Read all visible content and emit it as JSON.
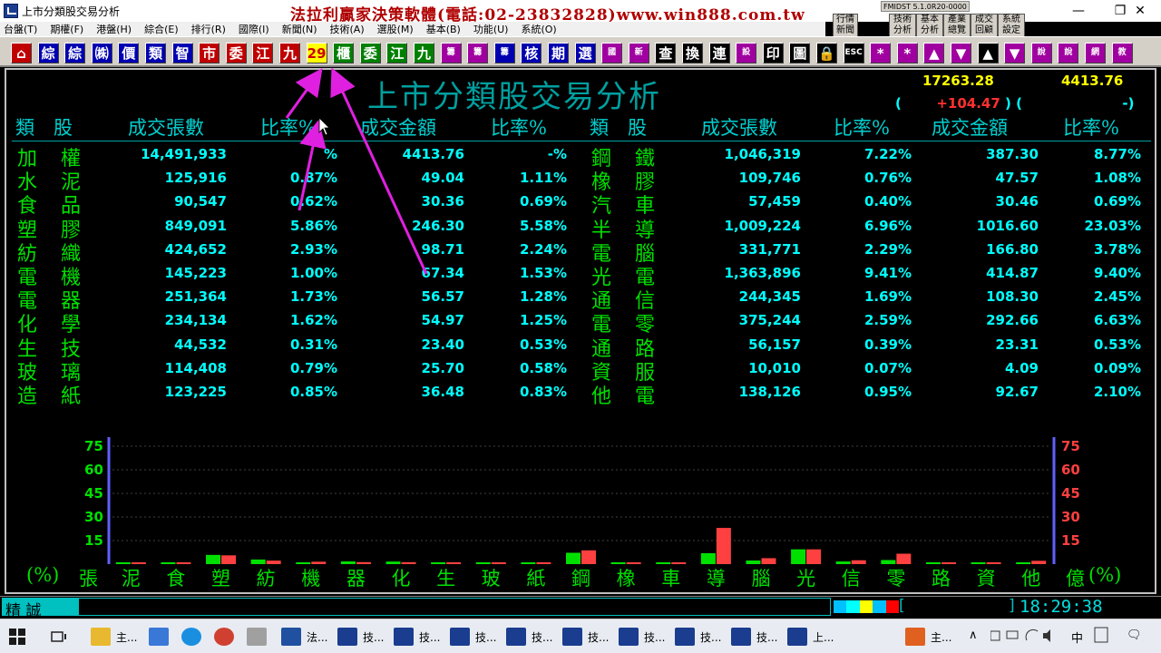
{
  "window": {
    "title": "上市分類股交易分析",
    "banner": "法拉利贏家決策軟體(電話:02-23832828)www.win888.com.tw",
    "version": "FMIDST 5.1.0R20-0000",
    "minimize": "—",
    "maximize": "❐",
    "close": "✕"
  },
  "system_buttons": [
    {
      "l1": "技術",
      "l2": "分析"
    },
    {
      "l1": "基本",
      "l2": "分析"
    },
    {
      "l1": "產業",
      "l2": "總覽"
    },
    {
      "l1": "成交",
      "l2": "回顧"
    },
    {
      "l1": "系統",
      "l2": "設定"
    }
  ],
  "system_small": {
    "l1": "行情",
    "l2": "新聞"
  },
  "menu": [
    "台盤(T)",
    "期權(F)",
    "港盤(H)",
    "綜合(E)",
    "排行(R)",
    "國際(I)",
    "新聞(N)",
    "技術(A)",
    "選股(M)",
    "基本(B)",
    "功能(U)",
    "系統(O)"
  ],
  "toolbar": [
    {
      "label": "⌂",
      "color": "r",
      "icon": "home-icon"
    },
    {
      "label": "綜",
      "color": "b"
    },
    {
      "label": "綜",
      "color": "b"
    },
    {
      "label": "㈱",
      "color": "b"
    },
    {
      "label": "價",
      "color": "b"
    },
    {
      "label": "類",
      "color": "b"
    },
    {
      "label": "智",
      "color": "b"
    },
    {
      "label": "市",
      "color": "r"
    },
    {
      "label": "委",
      "color": "r"
    },
    {
      "label": "江",
      "color": "r"
    },
    {
      "label": "九",
      "color": "r"
    },
    {
      "label": "29",
      "color": "y"
    },
    {
      "label": "櫃",
      "color": "g"
    },
    {
      "label": "委",
      "color": "g"
    },
    {
      "label": "江",
      "color": "g"
    },
    {
      "label": "九",
      "color": "g"
    },
    {
      "label": "籌",
      "color": "m",
      "small": true
    },
    {
      "label": "籌",
      "color": "m",
      "small": true
    },
    {
      "label": "籌",
      "color": "b",
      "small": true
    },
    {
      "label": "核",
      "color": "b"
    },
    {
      "label": "期",
      "color": "b"
    },
    {
      "label": "選",
      "color": "b"
    },
    {
      "label": "國",
      "color": "m",
      "small": true
    },
    {
      "label": "新",
      "color": "m",
      "small": true
    },
    {
      "label": "查",
      "color": "k"
    },
    {
      "label": "換",
      "color": "k"
    },
    {
      "label": "連",
      "color": "k"
    },
    {
      "label": "設",
      "color": "m",
      "small": true
    },
    {
      "label": "印",
      "color": "k"
    },
    {
      "label": "圖",
      "color": "k",
      "icon": "chart-icon"
    },
    {
      "label": "🔒",
      "color": "k",
      "icon": "lock-icon"
    },
    {
      "label": "ESC",
      "color": "k",
      "small": true
    },
    {
      "label": "*",
      "color": "m"
    },
    {
      "label": "*",
      "color": "m"
    },
    {
      "label": "▲",
      "color": "m",
      "icon": "up-icon"
    },
    {
      "label": "▼",
      "color": "m",
      "icon": "down-icon"
    },
    {
      "label": "▲",
      "color": "k",
      "icon": "top-icon"
    },
    {
      "label": "▼",
      "color": "m",
      "icon": "bottom-icon"
    },
    {
      "label": "說",
      "color": "m",
      "small": true
    },
    {
      "label": "說",
      "color": "m",
      "small": true
    },
    {
      "label": "網",
      "color": "m",
      "small": true
    },
    {
      "label": "教",
      "color": "m",
      "small": true
    }
  ],
  "page": {
    "title": "上市分類股交易分析",
    "index_value": "17263.28",
    "index_amount": "4413.76",
    "change_open": "(",
    "change": "+104.47",
    "change_mid": ")   (",
    "change_end": "-)"
  },
  "headers": {
    "category": "類　股",
    "volume": "成交張數",
    "ratio1": "比率%",
    "amount": "成交金額",
    "ratio2": "比率%"
  },
  "left_rows": [
    {
      "name": "加權",
      "volume": "14,491,933",
      "vol_pct": "%",
      "amount": "4413.76",
      "amt_pct": "-%"
    },
    {
      "name": "水泥",
      "volume": "125,916",
      "vol_pct": "0.87%",
      "amount": "49.04",
      "amt_pct": "1.11%"
    },
    {
      "name": "食品",
      "volume": "90,547",
      "vol_pct": "0.62%",
      "amount": "30.36",
      "amt_pct": "0.69%"
    },
    {
      "name": "塑膠",
      "volume": "849,091",
      "vol_pct": "5.86%",
      "amount": "246.30",
      "amt_pct": "5.58%"
    },
    {
      "name": "紡織",
      "volume": "424,652",
      "vol_pct": "2.93%",
      "amount": "98.71",
      "amt_pct": "2.24%"
    },
    {
      "name": "電機",
      "volume": "145,223",
      "vol_pct": "1.00%",
      "amount": "67.34",
      "amt_pct": "1.53%"
    },
    {
      "name": "電器",
      "volume": "251,364",
      "vol_pct": "1.73%",
      "amount": "56.57",
      "amt_pct": "1.28%"
    },
    {
      "name": "化學",
      "volume": "234,134",
      "vol_pct": "1.62%",
      "amount": "54.97",
      "amt_pct": "1.25%"
    },
    {
      "name": "生技",
      "volume": "44,532",
      "vol_pct": "0.31%",
      "amount": "23.40",
      "amt_pct": "0.53%"
    },
    {
      "name": "玻璃",
      "volume": "114,408",
      "vol_pct": "0.79%",
      "amount": "25.70",
      "amt_pct": "0.58%"
    },
    {
      "name": "造紙",
      "volume": "123,225",
      "vol_pct": "0.85%",
      "amount": "36.48",
      "amt_pct": "0.83%"
    }
  ],
  "right_rows": [
    {
      "name": "鋼鐵",
      "volume": "1,046,319",
      "vol_pct": "7.22%",
      "amount": "387.30",
      "amt_pct": "8.77%"
    },
    {
      "name": "橡膠",
      "volume": "109,746",
      "vol_pct": "0.76%",
      "amount": "47.57",
      "amt_pct": "1.08%"
    },
    {
      "name": "汽車",
      "volume": "57,459",
      "vol_pct": "0.40%",
      "amount": "30.46",
      "amt_pct": "0.69%"
    },
    {
      "name": "半導",
      "volume": "1,009,224",
      "vol_pct": "6.96%",
      "amount": "1016.60",
      "amt_pct": "23.03%"
    },
    {
      "name": "電腦",
      "volume": "331,771",
      "vol_pct": "2.29%",
      "amount": "166.80",
      "amt_pct": "3.78%"
    },
    {
      "name": "光電",
      "volume": "1,363,896",
      "vol_pct": "9.41%",
      "amount": "414.87",
      "amt_pct": "9.40%"
    },
    {
      "name": "通信",
      "volume": "244,345",
      "vol_pct": "1.69%",
      "amount": "108.30",
      "amt_pct": "2.45%"
    },
    {
      "name": "電零",
      "volume": "375,244",
      "vol_pct": "2.59%",
      "amount": "292.66",
      "amt_pct": "6.63%"
    },
    {
      "name": "通路",
      "volume": "56,157",
      "vol_pct": "0.39%",
      "amount": "23.31",
      "amt_pct": "0.53%"
    },
    {
      "name": "資服",
      "volume": "10,010",
      "vol_pct": "0.07%",
      "amount": "4.09",
      "amt_pct": "0.09%"
    },
    {
      "name": "他電",
      "volume": "138,126",
      "vol_pct": "0.95%",
      "amount": "92.67",
      "amt_pct": "2.10%"
    }
  ],
  "chart_data": {
    "type": "bar",
    "categories": [
      "泥",
      "食",
      "塑",
      "紡",
      "機",
      "器",
      "化",
      "生",
      "玻",
      "紙",
      "鋼",
      "橡",
      "車",
      "導",
      "腦",
      "光",
      "信",
      "零",
      "路",
      "資",
      "他"
    ],
    "series": [
      {
        "name": "張",
        "color": "#00e000",
        "values": [
          0.87,
          0.62,
          5.86,
          2.93,
          1.0,
          1.73,
          1.62,
          0.31,
          0.79,
          0.85,
          7.22,
          0.76,
          0.4,
          6.96,
          2.29,
          9.41,
          1.69,
          2.59,
          0.39,
          0.07,
          0.95
        ]
      },
      {
        "name": "億",
        "color": "#ff4040",
        "values": [
          1.11,
          0.69,
          5.58,
          2.24,
          1.53,
          1.28,
          1.25,
          0.53,
          0.58,
          0.83,
          8.77,
          1.08,
          0.69,
          23.03,
          3.78,
          9.4,
          2.45,
          6.63,
          0.53,
          0.09,
          2.1
        ]
      }
    ],
    "yticks": [
      "75",
      "60",
      "45",
      "30",
      "15"
    ],
    "ylim": [
      0,
      75
    ],
    "left_label_open": "(%)",
    "left_label": "張",
    "right_label": "億",
    "right_label_close": "(%)"
  },
  "status": {
    "user": "精 誠",
    "bracket_open": "[",
    "bracket_close": "]",
    "time": "18:29:38",
    "strip_colors": [
      "#00c0ff",
      "#00ffff",
      "#ffff00",
      "#00c0ff",
      "#ff0000"
    ]
  },
  "taskbar": {
    "items": [
      {
        "label": "主...",
        "icon": "folder-icon"
      },
      {
        "label": "",
        "icon": "network-icon"
      },
      {
        "label": "",
        "icon": "ie-icon"
      },
      {
        "label": "",
        "icon": "chrome-icon"
      },
      {
        "label": "",
        "icon": "paint-icon"
      },
      {
        "label": "法...",
        "icon": "app-icon"
      },
      {
        "label": "技...",
        "icon": "chart-app-icon"
      },
      {
        "label": "技...",
        "icon": "chart-app-icon"
      },
      {
        "label": "技...",
        "icon": "chart-app-icon"
      },
      {
        "label": "技...",
        "icon": "chart-app-icon"
      },
      {
        "label": "技...",
        "icon": "chart-app-icon"
      },
      {
        "label": "技...",
        "icon": "chart-app-icon"
      },
      {
        "label": "技...",
        "icon": "chart-app-icon"
      },
      {
        "label": "技...",
        "icon": "chart-app-icon"
      },
      {
        "label": "上...",
        "icon": "chart-app-icon"
      },
      {
        "label": "主...",
        "icon": "office-icon"
      }
    ],
    "ime": "中",
    "tray_up": "∧",
    "notify": "🗨"
  }
}
